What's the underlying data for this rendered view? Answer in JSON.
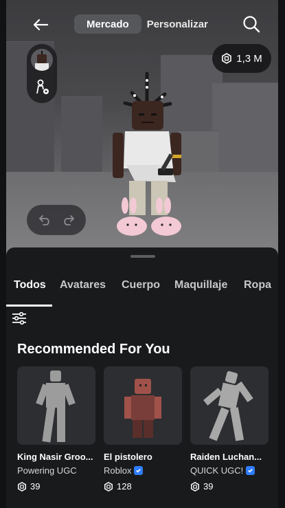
{
  "header": {
    "tabs": [
      {
        "label": "Mercado",
        "active": true
      },
      {
        "label": "Personalizar",
        "active": false
      }
    ],
    "back_icon": "arrow-left-icon",
    "search_icon": "search-icon"
  },
  "balance": {
    "icon": "robux-icon",
    "value": "1,3 M"
  },
  "categories": [
    "Todos",
    "Avatares",
    "Cuerpo",
    "Maquillaje",
    "Ropa"
  ],
  "section_title": "Recommended For You",
  "items": [
    {
      "name": "King Nasir Groo...",
      "creator": "Powering UGC",
      "verified": false,
      "price": "39"
    },
    {
      "name": "El pistolero",
      "creator": "Roblox",
      "verified": true,
      "price": "128"
    },
    {
      "name": "Raiden Luchan...",
      "creator": "QUICK UGC!",
      "verified": true,
      "price": "39"
    }
  ],
  "colors": {
    "background": "#111214",
    "sheet": "#191a1c",
    "card": "#2d2e31",
    "active_pill": "#55575b",
    "verified_badge": "#2f7dff"
  }
}
